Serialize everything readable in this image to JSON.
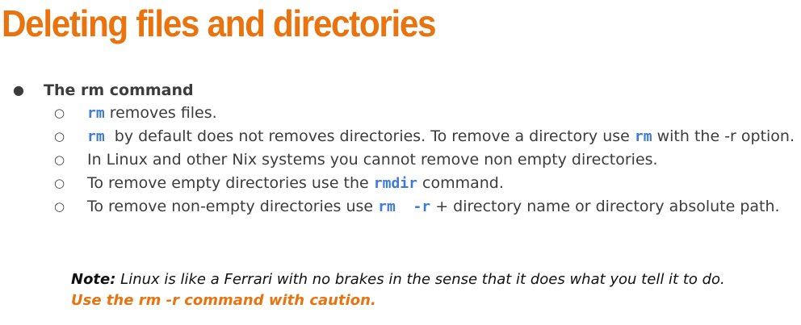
{
  "title": "Deleting files and directories",
  "section": {
    "bullet": "●",
    "heading": "The rm command",
    "sub_marker": "○",
    "items": [
      {
        "parts": [
          {
            "code": "rm"
          },
          {
            "text": " removes files."
          }
        ]
      },
      {
        "parts": [
          {
            "code": "rm"
          },
          {
            "text": "  by default does not removes directories. To remove a directory use "
          },
          {
            "code": "rm"
          },
          {
            "text": " with the -r option."
          }
        ]
      },
      {
        "parts": [
          {
            "text": "In Linux and other Nix systems you cannot remove non empty directories."
          }
        ]
      },
      {
        "parts": [
          {
            "text": "To remove empty directories use the "
          },
          {
            "code": "rmdir"
          },
          {
            "text": " command."
          }
        ]
      },
      {
        "parts": [
          {
            "text": "To remove non-empty directories use "
          },
          {
            "code": "rm  -r"
          },
          {
            "text": " + directory name or directory absolute path."
          }
        ]
      }
    ]
  },
  "note": {
    "label": "Note:",
    "text": " Linux is like a Ferrari with no brakes in the sense that it does what you tell it to do.",
    "caution": "Use the rm -r command with caution."
  },
  "colors": {
    "title": "#e8730f",
    "code": "#3d7bd6",
    "body_text": "#3c3c3c",
    "caution": "#e8730f"
  }
}
